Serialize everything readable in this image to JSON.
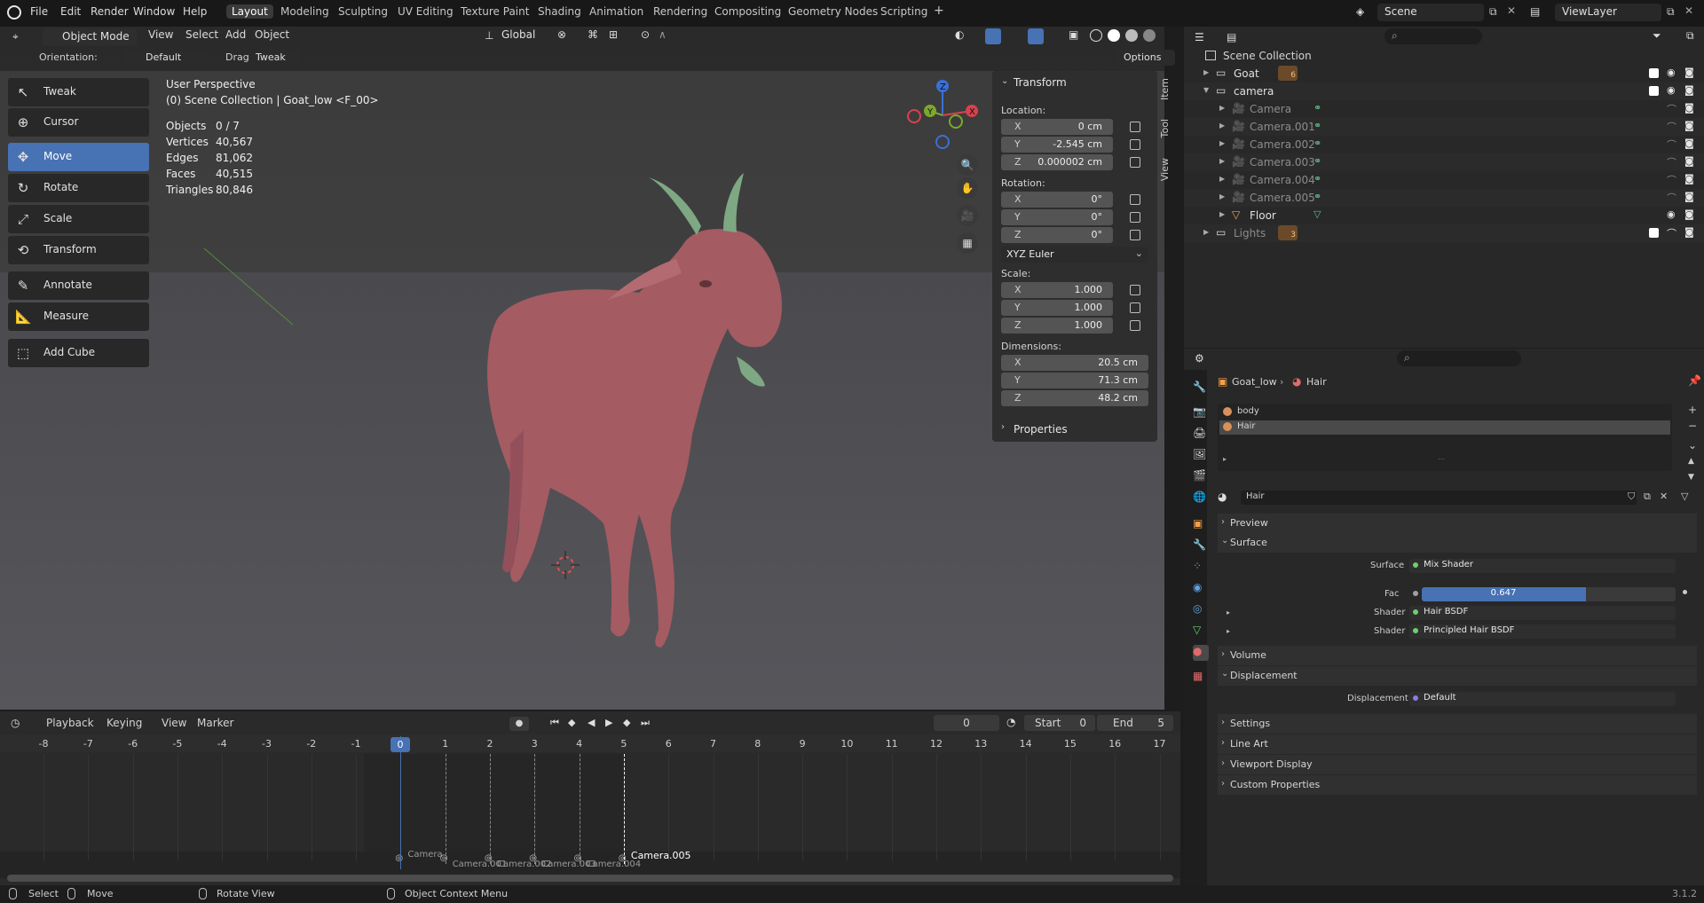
{
  "app": {
    "version": "3.1.2"
  },
  "menubar": {
    "items": [
      "File",
      "Edit",
      "Render",
      "Window",
      "Help"
    ]
  },
  "workspaces": {
    "tabs": [
      "Layout",
      "Modeling",
      "Sculpting",
      "UV Editing",
      "Texture Paint",
      "Shading",
      "Animation",
      "Rendering",
      "Compositing",
      "Geometry Nodes",
      "Scripting"
    ],
    "active": "Layout",
    "add": "+"
  },
  "scene": {
    "name": "Scene",
    "view_layer": "ViewLayer"
  },
  "viewport_header": {
    "mode": "Object Mode",
    "menus": [
      "View",
      "Select",
      "Add",
      "Object"
    ],
    "transform_orientation": "Global",
    "orientation_label": "Orientation:",
    "orientation_value": "Default",
    "drag_label": "Drag:",
    "drag_value": "Tweak",
    "options": "Options"
  },
  "toolbar": {
    "tools": [
      {
        "label": "Tweak",
        "icon": "tweak-icon"
      },
      {
        "label": "Cursor",
        "icon": "cursor-icon"
      },
      {
        "label": "Move",
        "icon": "move-icon",
        "active": true
      },
      {
        "label": "Rotate",
        "icon": "rotate-icon"
      },
      {
        "label": "Scale",
        "icon": "scale-icon"
      },
      {
        "label": "Transform",
        "icon": "transform-icon"
      },
      {
        "label": "Annotate",
        "icon": "annotate-icon"
      },
      {
        "label": "Measure",
        "icon": "measure-icon"
      },
      {
        "label": "Add Cube",
        "icon": "add-cube-icon"
      }
    ]
  },
  "overlay": {
    "view_name": "User Perspective",
    "context": "(0) Scene Collection | Goat_low <F_00>",
    "stats": [
      {
        "label": "Objects",
        "value": "0 / 7"
      },
      {
        "label": "Vertices",
        "value": "40,567"
      },
      {
        "label": "Edges",
        "value": "81,062"
      },
      {
        "label": "Faces",
        "value": "40,515"
      },
      {
        "label": "Triangles",
        "value": "80,846"
      }
    ]
  },
  "gizmo": {
    "z": "Z",
    "y": "Y",
    "x": "X"
  },
  "npanel": {
    "tabs": [
      "Item",
      "Tool",
      "View"
    ],
    "transform_title": "Transform",
    "location_label": "Location:",
    "location": [
      {
        "axis": "X",
        "value": "0 cm"
      },
      {
        "axis": "Y",
        "value": "-2.545 cm"
      },
      {
        "axis": "Z",
        "value": "0.000002 cm"
      }
    ],
    "rotation_label": "Rotation:",
    "rotation": [
      {
        "axis": "X",
        "value": "0°"
      },
      {
        "axis": "Y",
        "value": "0°"
      },
      {
        "axis": "Z",
        "value": "0°"
      }
    ],
    "rotation_mode": "XYZ Euler",
    "scale_label": "Scale:",
    "scale": [
      {
        "axis": "X",
        "value": "1.000"
      },
      {
        "axis": "Y",
        "value": "1.000"
      },
      {
        "axis": "Z",
        "value": "1.000"
      }
    ],
    "dimensions_label": "Dimensions:",
    "dimensions": [
      {
        "axis": "X",
        "value": "20.5 cm"
      },
      {
        "axis": "Y",
        "value": "71.3 cm"
      },
      {
        "axis": "Z",
        "value": "48.2 cm"
      }
    ],
    "properties_title": "Properties"
  },
  "outliner": {
    "root": "Scene Collection",
    "rows": [
      {
        "label": "Goat",
        "indent": 1,
        "badge": "6",
        "kind": "collection"
      },
      {
        "label": "camera",
        "indent": 1,
        "kind": "collection",
        "expanded": true
      },
      {
        "label": "Camera",
        "indent": 2,
        "kind": "camera",
        "dim": true
      },
      {
        "label": "Camera.001",
        "indent": 2,
        "kind": "camera",
        "dim": true
      },
      {
        "label": "Camera.002",
        "indent": 2,
        "kind": "camera",
        "dim": true
      },
      {
        "label": "Camera.003",
        "indent": 2,
        "kind": "camera",
        "dim": true
      },
      {
        "label": "Camera.004",
        "indent": 2,
        "kind": "camera",
        "dim": true
      },
      {
        "label": "Camera.005",
        "indent": 2,
        "kind": "camera",
        "dim": true
      },
      {
        "label": "Floor",
        "indent": 2,
        "kind": "mesh"
      },
      {
        "label": "Lights",
        "indent": 1,
        "badge": "3",
        "kind": "collection",
        "dim": true
      }
    ]
  },
  "properties": {
    "breadcrumb_object": "Goat_low",
    "breadcrumb_material": "Hair",
    "material_slots": [
      "body",
      "Hair"
    ],
    "material_name": "Hair",
    "sections": {
      "preview": "Preview",
      "surface": "Surface",
      "volume": "Volume",
      "displacement": "Displacement",
      "settings": "Settings",
      "line_art": "Line Art",
      "viewport_display": "Viewport Display",
      "custom_properties": "Custom Properties"
    },
    "surface_label": "Surface",
    "surface_value": "Mix Shader",
    "fac_label": "Fac",
    "fac_value": "0.647",
    "fac_fraction": 0.647,
    "shader_label": "Shader",
    "shader1": "Hair BSDF",
    "shader2": "Principled Hair BSDF",
    "displacement_label": "Displacement",
    "displacement_value": "Default"
  },
  "timeline": {
    "menus": [
      "Playback",
      "Keying",
      "View",
      "Marker"
    ],
    "current_frame": "0",
    "start_label": "Start",
    "start": "0",
    "end_label": "End",
    "end": "5",
    "ticks": [
      "-8",
      "-7",
      "-6",
      "-5",
      "-4",
      "-3",
      "-2",
      "-1",
      "0",
      "1",
      "2",
      "3",
      "4",
      "5",
      "6",
      "7",
      "8",
      "9",
      "10",
      "11",
      "12",
      "13",
      "14",
      "15",
      "16",
      "17"
    ],
    "markers": [
      "Camera",
      "Camera.001",
      "Camera.002",
      "Camera.003",
      "Camera.004",
      "Camera.005"
    ]
  },
  "statusbar": {
    "select": "Select",
    "move": "Move",
    "rotate_view": "Rotate View",
    "context_menu": "Object Context Menu"
  },
  "colors": {
    "accent": "#4772b3",
    "goat": "#a45b62",
    "horn": "#7ea883",
    "background": "#1d1d1d"
  }
}
